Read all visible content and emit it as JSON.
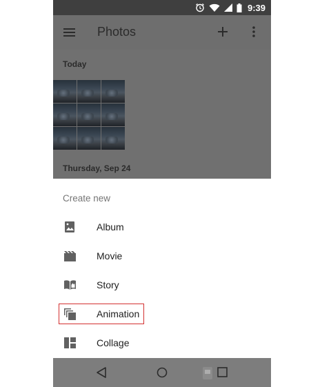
{
  "status_bar": {
    "time": "9:39",
    "icons": [
      "alarm-icon",
      "wifi-icon",
      "signal-icon",
      "battery-icon"
    ]
  },
  "app_bar": {
    "title": "Photos",
    "icons": [
      "menu-icon",
      "add-icon",
      "overflow-menu-icon"
    ]
  },
  "timeline": {
    "sections": [
      "Today",
      "Thursday, Sep 24"
    ],
    "today_photo_count": 9
  },
  "create_new": {
    "title": "Create new",
    "items": [
      {
        "label": "Album",
        "icon": "album-icon"
      },
      {
        "label": "Movie",
        "icon": "movie-icon"
      },
      {
        "label": "Story",
        "icon": "story-icon"
      },
      {
        "label": "Animation",
        "icon": "animation-icon",
        "highlighted": true
      },
      {
        "label": "Collage",
        "icon": "collage-icon"
      }
    ]
  },
  "nav_bar": {
    "icons": [
      "back-icon",
      "home-icon",
      "recents-icon"
    ]
  },
  "colors": {
    "highlight_border": "#d32f2f",
    "scrim_app_bar": "#6e6e6e",
    "status_bar": "#3f3f3f",
    "nav_bar": "#7d7d7d"
  }
}
